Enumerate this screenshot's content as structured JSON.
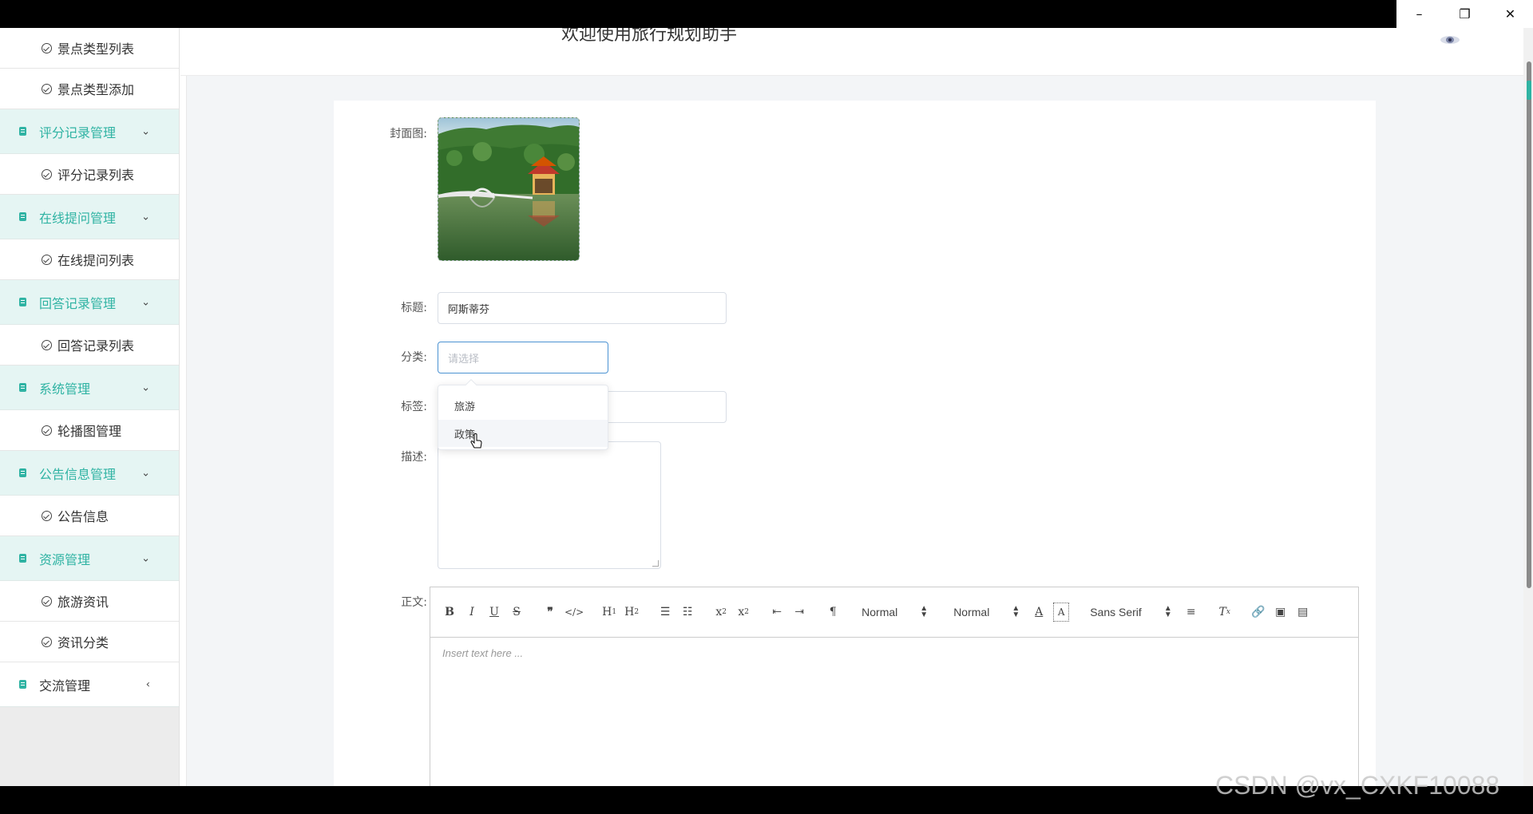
{
  "window": {
    "minimize": "–",
    "restore": "❐",
    "close": "✕"
  },
  "header": {
    "title": "欢迎使用旅行规划助手"
  },
  "sidebar": {
    "items": [
      {
        "type": "sub",
        "label": "景点类型列表"
      },
      {
        "type": "sub",
        "label": "景点类型添加"
      },
      {
        "type": "group",
        "label": "评分记录管理",
        "chevron": "⌄"
      },
      {
        "type": "sub",
        "label": "评分记录列表"
      },
      {
        "type": "group",
        "label": "在线提问管理",
        "chevron": "⌄"
      },
      {
        "type": "sub",
        "label": "在线提问列表"
      },
      {
        "type": "group",
        "label": "回答记录管理",
        "chevron": "⌄"
      },
      {
        "type": "sub",
        "label": "回答记录列表"
      },
      {
        "type": "group",
        "label": "系统管理",
        "chevron": "⌄"
      },
      {
        "type": "sub",
        "label": "轮播图管理"
      },
      {
        "type": "group",
        "label": "公告信息管理",
        "chevron": "⌄"
      },
      {
        "type": "sub",
        "label": "公告信息"
      },
      {
        "type": "group",
        "label": "资源管理",
        "chevron": "⌄"
      },
      {
        "type": "sub",
        "label": "旅游资讯"
      },
      {
        "type": "sub",
        "label": "资讯分类"
      },
      {
        "type": "group-plain",
        "label": "交流管理",
        "chevron": "‹"
      }
    ]
  },
  "form": {
    "cover_label": "封面图:",
    "title_label": "标题:",
    "title_value": "阿斯蒂芬",
    "category_label": "分类:",
    "category_placeholder": "请选择",
    "tags_label": "标签:",
    "desc_label": "描述:",
    "body_label": "正文:",
    "category_options": [
      "旅游",
      "政策"
    ],
    "hovered_option": "政策"
  },
  "editor": {
    "placeholder": "Insert text here ...",
    "header_select": "Normal",
    "size_select": "Normal",
    "font_select": "Sans Serif"
  },
  "watermark": "CSDN @vx_CXKF10088",
  "colors": {
    "accent": "#2fb3a3",
    "focus": "#4b92d2"
  }
}
